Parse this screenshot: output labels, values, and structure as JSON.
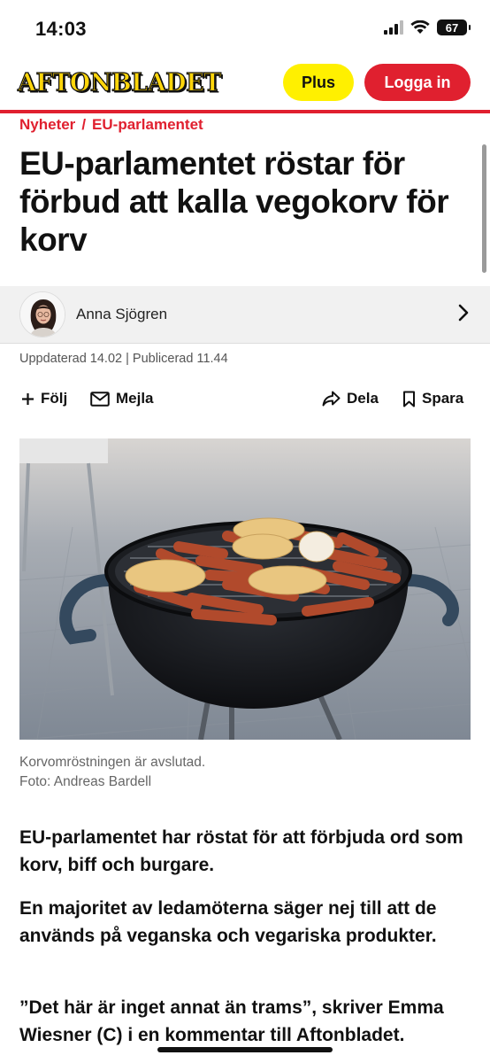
{
  "status_bar": {
    "time": "14:03",
    "battery": "67"
  },
  "header": {
    "logo": "AFTONBLADET",
    "plus_label": "Plus",
    "login_label": "Logga in",
    "brand_red": "#e0202f",
    "brand_yellow": "#ffd60a"
  },
  "breadcrumb": {
    "section": "Nyheter",
    "separator": "/",
    "subsection": "EU-parlamentet"
  },
  "article": {
    "headline": "EU-parlamentet röstar för förbud att kalla vegokorv för korv",
    "author": "Anna Sjögren",
    "dates": "Uppdaterad 14.02 | Publicerad 11.44",
    "actions": {
      "follow": "Följ",
      "email": "Mejla",
      "share": "Dela",
      "save": "Spara"
    },
    "image_caption": "Korvomröstningen är avslutad.",
    "image_credit": "Foto: Andreas Bardell",
    "paragraphs": [
      "EU-parlamentet har röstat för att förbjuda ord som korv, biff och burgare.",
      "En majoritet av ledamöterna säger nej till att de används på veganska och vegariska produkter.",
      "”Det här är inget annat än trams”, skriver Emma Wiesner (C) i en kommentar till Aftonbladet."
    ]
  }
}
